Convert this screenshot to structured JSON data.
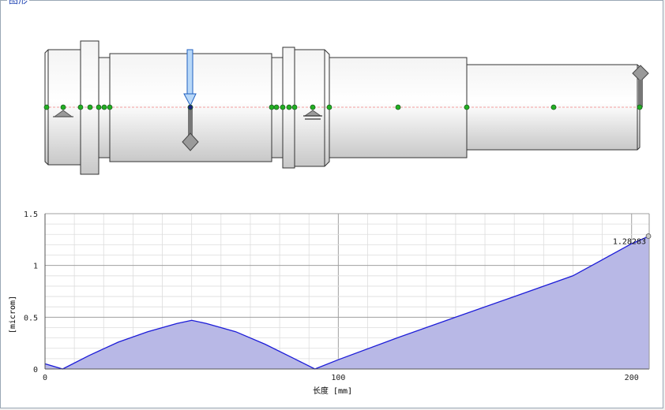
{
  "panel": {
    "caption": "图形"
  },
  "shaft": {
    "node_count": 21,
    "colors": {
      "node": "#22b022",
      "selected_node": "#1a237e",
      "centerline": "#f08080",
      "arrow_fill": "#b8d8f8",
      "arrow_stroke": "#2060c0",
      "marker": "#8a8a8a"
    },
    "icons": [
      "fixed-bearing-support-icon",
      "floating-bearing-support-icon",
      "load-arrow-icon",
      "diamond-marker-icon"
    ]
  },
  "chart_data": {
    "type": "area",
    "title": "",
    "xlabel": "长度 [mm]",
    "ylabel": "[microm]",
    "xlim": [
      0,
      206
    ],
    "ylim": [
      0,
      1.5
    ],
    "x_ticks": [
      "0",
      "100",
      "200"
    ],
    "y_ticks": [
      "0",
      "0.5",
      "1",
      "1.5"
    ],
    "grid": true,
    "legend": "none",
    "series": [
      {
        "color": "#1c1cd8",
        "fill": "#b8b8e6",
        "x": [
          0,
          6,
          15,
          25,
          35,
          45,
          50,
          55,
          65,
          75,
          85,
          92,
          100,
          120,
          140,
          160,
          180,
          200,
          206
        ],
        "y": [
          0.05,
          0,
          0.13,
          0.26,
          0.36,
          0.44,
          0.47,
          0.44,
          0.36,
          0.24,
          0.1,
          0,
          0.09,
          0.3,
          0.5,
          0.7,
          0.9,
          1.21,
          1.28283
        ]
      }
    ],
    "annotations": [
      {
        "x": 206,
        "y": 1.28283,
        "text": "1.28283"
      }
    ]
  }
}
